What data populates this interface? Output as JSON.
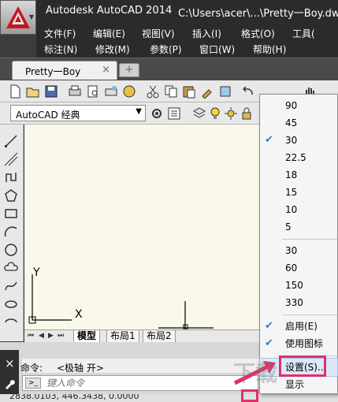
{
  "window": {
    "app_title": "Autodesk AutoCAD 2014",
    "file_title": "C:\\Users\\acer\\...\\Pretty一Boy.dwg"
  },
  "menubar": {
    "row1": [
      "文件(F)",
      "编辑(E)",
      "视图(V)",
      "插入(I)",
      "格式(O)",
      "工具("
    ],
    "row2": [
      "标注(N)",
      "修改(M)",
      "参数(P)",
      "窗口(W)",
      "帮助(H)"
    ]
  },
  "tabs": {
    "document": "Pretty一Boy",
    "close": "×",
    "new": "+"
  },
  "workspace": {
    "value": "AutoCAD 经典"
  },
  "canvas": {
    "axis_y": "Y",
    "axis_x": "X"
  },
  "layout_tabs": [
    "模型",
    "布局1",
    "布局2"
  ],
  "command": {
    "label": "命令:",
    "history": "<极轴  开>",
    "placeholder": "键入命令",
    "close": "×"
  },
  "status": {
    "coords": "2838.0103,  446.3438,  0.0000"
  },
  "context_menu": {
    "items": [
      {
        "label": "90",
        "checked": false
      },
      {
        "label": "45",
        "checked": false
      },
      {
        "label": "30",
        "checked": true
      },
      {
        "label": "22.5",
        "checked": false
      },
      {
        "label": "18",
        "checked": false
      },
      {
        "label": "15",
        "checked": false
      },
      {
        "label": "10",
        "checked": false
      },
      {
        "label": "5",
        "checked": false
      },
      {
        "label": "30",
        "checked": false
      },
      {
        "label": "60",
        "checked": false
      },
      {
        "label": "150",
        "checked": false
      },
      {
        "label": "330",
        "checked": false
      },
      {
        "label": "启用(E)",
        "checked": true
      },
      {
        "label": "使用图标(U)",
        "checked": true
      },
      {
        "label": "设置(S)...",
        "checked": false,
        "highlighted": true
      },
      {
        "label": "显示",
        "checked": false
      }
    ],
    "check_mark": "✔"
  },
  "watermark": "下载",
  "colors": {
    "accent": "#e0306a",
    "titlebar": "#2b2b2b",
    "canvas": "#faf8ea"
  }
}
